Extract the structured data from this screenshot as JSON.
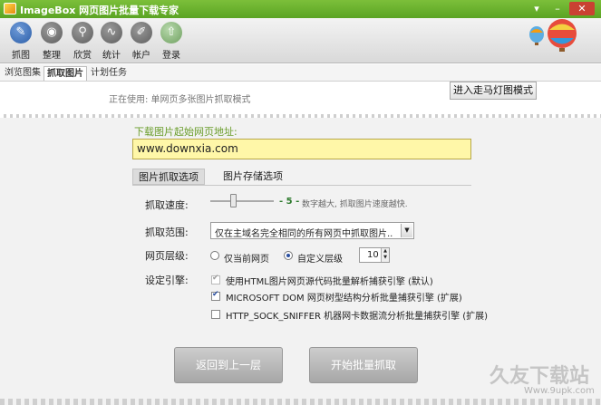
{
  "window": {
    "title": "ImageBox 网页图片批量下载专家"
  },
  "toolbar": {
    "items": [
      {
        "label": "抓图",
        "icon": "brush-icon"
      },
      {
        "label": "整理",
        "icon": "disc-icon"
      },
      {
        "label": "欣赏",
        "icon": "magnifier-icon"
      },
      {
        "label": "统计",
        "icon": "wave-icon"
      },
      {
        "label": "帐户",
        "icon": "wrench-icon"
      },
      {
        "label": "登录",
        "icon": "upload-cloud-icon"
      }
    ]
  },
  "tabs": [
    {
      "label": "浏览图集"
    },
    {
      "label": "抓取图片"
    },
    {
      "label": "计划任务"
    }
  ],
  "status": {
    "text": "正在使用: 单网页多张图片抓取模式"
  },
  "carousel_button": "进入走马灯图模式",
  "form": {
    "url_label": "下载图片起始网页地址:",
    "url_value": "www.downxia.com",
    "subtabs": [
      "图片抓取选项",
      "图片存储选项"
    ],
    "speed": {
      "label": "抓取速度:",
      "value": "5",
      "hint": "数字越大, 抓取图片速度越快."
    },
    "range": {
      "label": "抓取范围:",
      "selected": "仅在主域名完全相同的所有网页中抓取图片.."
    },
    "level": {
      "label": "网页层级:",
      "opt1": "仅当前网页",
      "opt2": "自定义层级",
      "value": "10"
    },
    "engine": {
      "label": "设定引擎:",
      "options": [
        {
          "text": "使用HTML图片网页源代码批量解析捕获引擎 (默认)",
          "checked": true,
          "disabled": true
        },
        {
          "text": "MICROSOFT DOM 网页树型结构分析批量捕获引擎 (扩展)",
          "checked": true,
          "disabled": false
        },
        {
          "text": "HTTP_SOCK_SNIFFER 机器网卡数据流分析批量捕获引擎 (扩展)",
          "checked": false,
          "disabled": false
        }
      ]
    }
  },
  "buttons": {
    "back": "返回到上一层",
    "start": "开始批量抓取"
  },
  "watermark": {
    "text": "久友下载站",
    "url": "Www.9upk.com"
  }
}
